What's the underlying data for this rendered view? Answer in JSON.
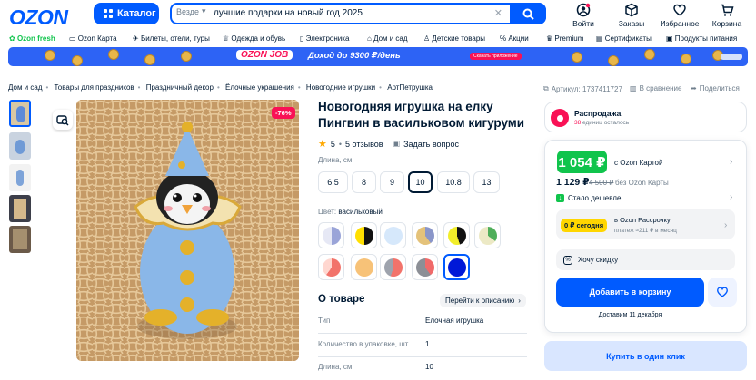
{
  "header": {
    "logo": "OZON",
    "catalog_label": "Каталог",
    "search_scope": "Везде",
    "search_query": "лучшие подарки на новый год 2025",
    "actions": [
      {
        "label": "Войти",
        "icon": "user-icon"
      },
      {
        "label": "Заказы",
        "icon": "box-icon"
      },
      {
        "label": "Избранное",
        "icon": "heart-icon"
      },
      {
        "label": "Корзина",
        "icon": "cart-icon"
      }
    ]
  },
  "nav": [
    "Ozon fresh",
    "Ozon Карта",
    "Билеты, отели, туры",
    "Одежда и обувь",
    "Электроника",
    "Дом и сад",
    "Детские товары",
    "Акции",
    "Premium",
    "Сертификаты",
    "Продукты питания"
  ],
  "banner": {
    "brand": "OZON JOB",
    "text": "Доход до 9300 ₽/день",
    "cta": "Скачать приложение"
  },
  "breadcrumbs": [
    "Дом и сад",
    "Товары для праздников",
    "Праздничный декор",
    "Ёлочные украшения",
    "Новогодние игрушки",
    "АртПетрушка"
  ],
  "meta": {
    "article": "Артикул: 1737411727",
    "compare": "В сравнение",
    "share": "Поделиться"
  },
  "product": {
    "discount_badge": "-76%",
    "title": "Новогодняя игрушка на елку Пингвин в васильковом кигуруми",
    "rating": "5",
    "reviews": "5 отзывов",
    "ask": "Задать вопрос",
    "length_label": "Длина, см:",
    "sizes": [
      "6.5",
      "8",
      "9",
      "10",
      "10.8",
      "13"
    ],
    "selected_size": "10",
    "color_label": "Цвет:",
    "color_value": "васильковый",
    "about_title": "О товаре",
    "to_description": "Перейти к описанию",
    "specs": [
      {
        "k": "Тип",
        "v": "Елочная игрушка"
      },
      {
        "k": "Количество в упаковке, шт",
        "v": "1"
      },
      {
        "k": "Длина, см",
        "v": "10"
      }
    ]
  },
  "buy": {
    "sale_title": "Распродажа",
    "sale_sub_count": "38",
    "sale_sub_text": "единиц осталось",
    "price_card": "1 054 ₽",
    "price_card_note": "с Ozon Картой",
    "price": "1 129 ₽",
    "price_old": "4 500 ₽",
    "price_note": "без Ozon Карты",
    "cheaper": "Стало дешевле",
    "installment_badge": "0 ₽ сегодня",
    "installment_title": "в Ozon Рассрочку",
    "installment_note": "платеж ≈211 ₽ в месяц",
    "discount_want": "Хочу скидку",
    "add_to_cart": "Добавить в корзину",
    "delivery": "Доставим 11 декабря",
    "one_click": "Купить в один клик"
  },
  "colors": {
    "accent": "#005bff",
    "green": "#10c44c",
    "pink": "#f91155"
  }
}
